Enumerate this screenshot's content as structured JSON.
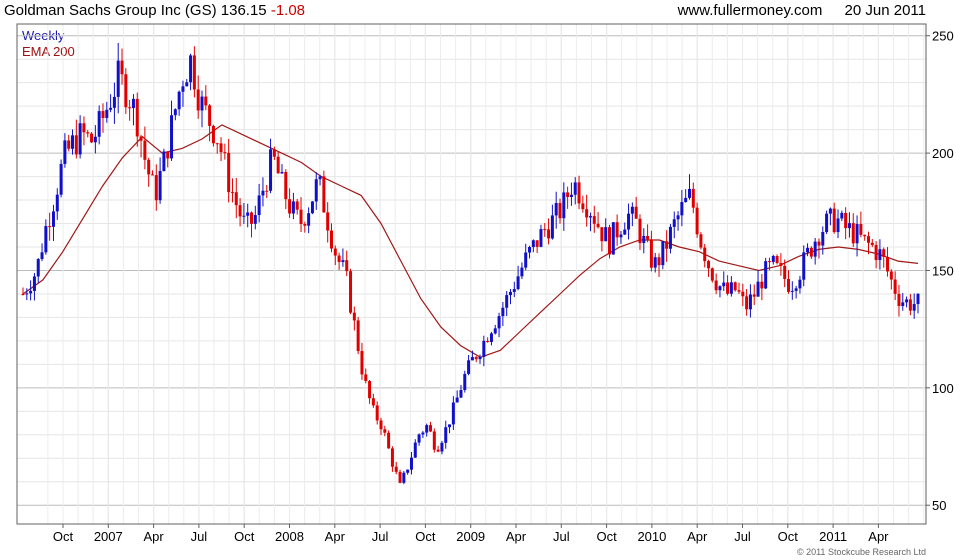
{
  "header": {
    "symbol_title": "Goldman Sachs Group Inc (GS)",
    "last_price": "136.15",
    "change": "-1.08",
    "website": "www.fullermoney.com",
    "date": "20 Jun 2011"
  },
  "legend": {
    "period": "Weekly",
    "indicator": "EMA 200"
  },
  "credit": "© 2011 Stockcube Research Ltd",
  "colors": {
    "up": "#1010c8",
    "down": "#e00000",
    "ema": "#a01818",
    "grid": "#d4d4d4",
    "frame": "#606060"
  },
  "chart_data": {
    "type": "candlestick",
    "period": "Weekly",
    "y_axis": {
      "position": "right",
      "ylim": [
        42,
        255
      ],
      "ticks": [
        50,
        100,
        150,
        200,
        250
      ]
    },
    "x_ticks": [
      "Oct",
      "2007",
      "Apr",
      "Jul",
      "Oct",
      "2008",
      "Apr",
      "Jul",
      "Oct",
      "2009",
      "Apr",
      "Jul",
      "Oct",
      "2010",
      "Apr",
      "Jul",
      "Oct",
      "2011",
      "Apr"
    ],
    "x_tick_positions": [
      0.1,
      0.2,
      0.35,
      0.5,
      0.65,
      0.8,
      0.95,
      1.1,
      1.25,
      1.4,
      1.55,
      1.7,
      1.85,
      2.0,
      2.15,
      2.3,
      2.45,
      2.6,
      2.75
    ],
    "grid": true,
    "series": [
      {
        "name": "Weekly",
        "style": "candles",
        "points": [
          [
            0.0,
            140
          ],
          [
            0.15,
            150
          ],
          [
            0.25,
            168
          ],
          [
            0.35,
            182
          ],
          [
            0.45,
            198
          ],
          [
            0.55,
            204
          ],
          [
            0.65,
            208
          ],
          [
            0.75,
            205
          ],
          [
            0.85,
            212
          ],
          [
            0.95,
            222
          ],
          [
            1.05,
            232
          ],
          [
            1.15,
            226
          ],
          [
            1.25,
            216
          ],
          [
            1.35,
            196
          ],
          [
            1.45,
            182
          ],
          [
            1.55,
            196
          ],
          [
            1.65,
            214
          ],
          [
            1.75,
            232
          ],
          [
            1.85,
            240
          ],
          [
            1.95,
            222
          ],
          [
            2.05,
            214
          ],
          [
            2.15,
            206
          ],
          [
            2.25,
            190
          ],
          [
            2.35,
            178
          ],
          [
            2.45,
            168
          ],
          [
            2.55,
            172
          ],
          [
            2.65,
            186
          ],
          [
            2.75,
            198
          ],
          [
            2.85,
            186
          ],
          [
            2.95,
            176
          ],
          [
            3.05,
            170
          ],
          [
            3.15,
            178
          ],
          [
            3.25,
            188
          ],
          [
            3.35,
            172
          ],
          [
            3.45,
            156
          ],
          [
            3.55,
            148
          ],
          [
            3.65,
            126
          ],
          [
            3.75,
            104
          ],
          [
            3.85,
            90
          ],
          [
            3.95,
            84
          ],
          [
            4.05,
            70
          ],
          [
            4.15,
            58
          ],
          [
            4.25,
            68
          ],
          [
            4.35,
            80
          ],
          [
            4.45,
            84
          ],
          [
            4.55,
            74
          ],
          [
            4.65,
            82
          ],
          [
            4.75,
            92
          ],
          [
            4.85,
            104
          ],
          [
            4.95,
            112
          ],
          [
            5.05,
            118
          ],
          [
            5.15,
            126
          ],
          [
            5.25,
            132
          ],
          [
            5.35,
            140
          ],
          [
            5.45,
            148
          ],
          [
            5.55,
            156
          ],
          [
            5.65,
            162
          ],
          [
            5.75,
            168
          ],
          [
            5.85,
            172
          ],
          [
            5.95,
            178
          ],
          [
            6.05,
            188
          ],
          [
            6.15,
            182
          ],
          [
            6.25,
            176
          ],
          [
            6.35,
            168
          ],
          [
            6.45,
            162
          ],
          [
            6.55,
            168
          ],
          [
            6.65,
            174
          ],
          [
            6.75,
            170
          ],
          [
            6.85,
            160
          ],
          [
            6.95,
            152
          ],
          [
            7.05,
            158
          ],
          [
            7.15,
            168
          ],
          [
            7.25,
            176
          ],
          [
            7.35,
            182
          ],
          [
            7.45,
            164
          ],
          [
            7.55,
            152
          ],
          [
            7.65,
            144
          ],
          [
            7.75,
            140
          ],
          [
            7.85,
            142
          ],
          [
            7.95,
            134
          ],
          [
            8.05,
            140
          ],
          [
            8.15,
            148
          ],
          [
            8.25,
            152
          ],
          [
            8.35,
            148
          ],
          [
            8.45,
            144
          ],
          [
            8.55,
            150
          ],
          [
            8.65,
            158
          ],
          [
            8.75,
            166
          ],
          [
            8.85,
            170
          ],
          [
            8.95,
            172
          ],
          [
            9.05,
            168
          ],
          [
            9.15,
            166
          ],
          [
            9.25,
            162
          ],
          [
            9.35,
            160
          ],
          [
            9.45,
            156
          ],
          [
            9.55,
            146
          ],
          [
            9.65,
            138
          ],
          [
            9.75,
            136
          ],
          [
            9.85,
            136
          ]
        ]
      },
      {
        "name": "EMA 200",
        "style": "line",
        "points": [
          [
            0.0,
            140
          ],
          [
            0.5,
            146
          ],
          [
            1.0,
            158
          ],
          [
            1.5,
            172
          ],
          [
            2.0,
            186
          ],
          [
            2.5,
            198
          ],
          [
            3.0,
            207
          ],
          [
            3.5,
            200
          ],
          [
            4.0,
            202
          ],
          [
            4.5,
            206
          ],
          [
            5.0,
            212
          ],
          [
            5.5,
            208
          ],
          [
            6.0,
            204
          ],
          [
            6.5,
            200
          ],
          [
            7.0,
            196
          ],
          [
            7.5,
            190
          ],
          [
            8.0,
            186
          ],
          [
            8.5,
            182
          ],
          [
            9.0,
            170
          ],
          [
            9.5,
            154
          ],
          [
            10.0,
            138
          ],
          [
            10.5,
            126
          ],
          [
            11.0,
            118
          ],
          [
            11.5,
            113
          ],
          [
            12.0,
            116
          ],
          [
            12.5,
            124
          ],
          [
            13.0,
            132
          ],
          [
            13.5,
            140
          ],
          [
            14.0,
            148
          ],
          [
            14.5,
            155
          ],
          [
            15.0,
            160
          ],
          [
            15.5,
            163
          ],
          [
            16.0,
            163
          ],
          [
            16.5,
            160
          ],
          [
            17.0,
            158
          ],
          [
            17.5,
            154
          ],
          [
            18.0,
            152
          ],
          [
            18.5,
            150
          ],
          [
            19.0,
            152
          ],
          [
            19.5,
            156
          ],
          [
            20.0,
            159
          ],
          [
            20.5,
            160
          ],
          [
            21.0,
            159
          ],
          [
            21.5,
            157
          ],
          [
            22.0,
            154
          ],
          [
            22.5,
            153
          ]
        ]
      }
    ]
  }
}
